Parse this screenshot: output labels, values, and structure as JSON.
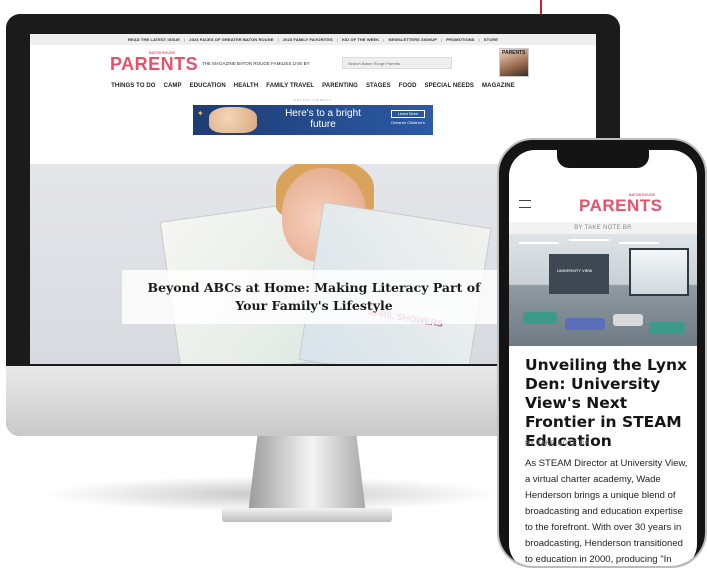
{
  "desktop": {
    "top_links": [
      "READ THE LATEST ISSUE",
      "2024 FACES OF GREATER BATON ROUGE",
      "2023 FAMILY FAVORITES",
      "KID OF THE WEEK",
      "NEWSLETTERS SIGNUP",
      "PROMOTIONS",
      "STORE"
    ],
    "logo_small": "BATON ROUGE",
    "logo": "PARENTS",
    "tagline": "THE MAGAZINE BATON ROUGE FAMILIES LIVE BY",
    "search_placeholder": "Search Baton Rouge Parents",
    "magazine_label": "PARENTS",
    "nav": [
      "THINGS TO DO",
      "CAMP",
      "EDUCATION",
      "HEALTH",
      "FAMILY TRAVEL",
      "PARENTING",
      "STAGES",
      "FOOD",
      "SPECIAL NEEDS",
      "MAGAZINE"
    ],
    "ad": {
      "label": "ADVERTISEMENT",
      "headline": "Here's to a bright future",
      "button": "Learn More",
      "sponsor": "Ochsner Children's"
    },
    "hero": {
      "newspaper_text": "APRIL SHOWERS",
      "caption": "Beyond ABCs at Home: Making Literacy Part of Your Family's Lifestyle"
    }
  },
  "phone": {
    "logo_small": "BATON ROUGE",
    "logo": "PARENTS",
    "sub_label": "BY TAKE NOTE BR",
    "photo_sign": "UNIVERSITY VIEW",
    "title": "Unveiling the Lynx Den: University View's Next Frontier in STEAM Education",
    "byline": "BY TAKE NOTE BR",
    "body": "As STEAM Director at University View, a virtual charter academy, Wade Henderson brings a unique blend of broadcasting and education expertise to the forefront. With over 30 years in broadcasting, Henderson transitioned to education in 2000, producing \"In School.\" This paved his way to"
  },
  "colors": {
    "brand_pink": "#e9506a",
    "ad_blue": "#1d3c72",
    "monitor_bezel": "#1b1b1b"
  }
}
